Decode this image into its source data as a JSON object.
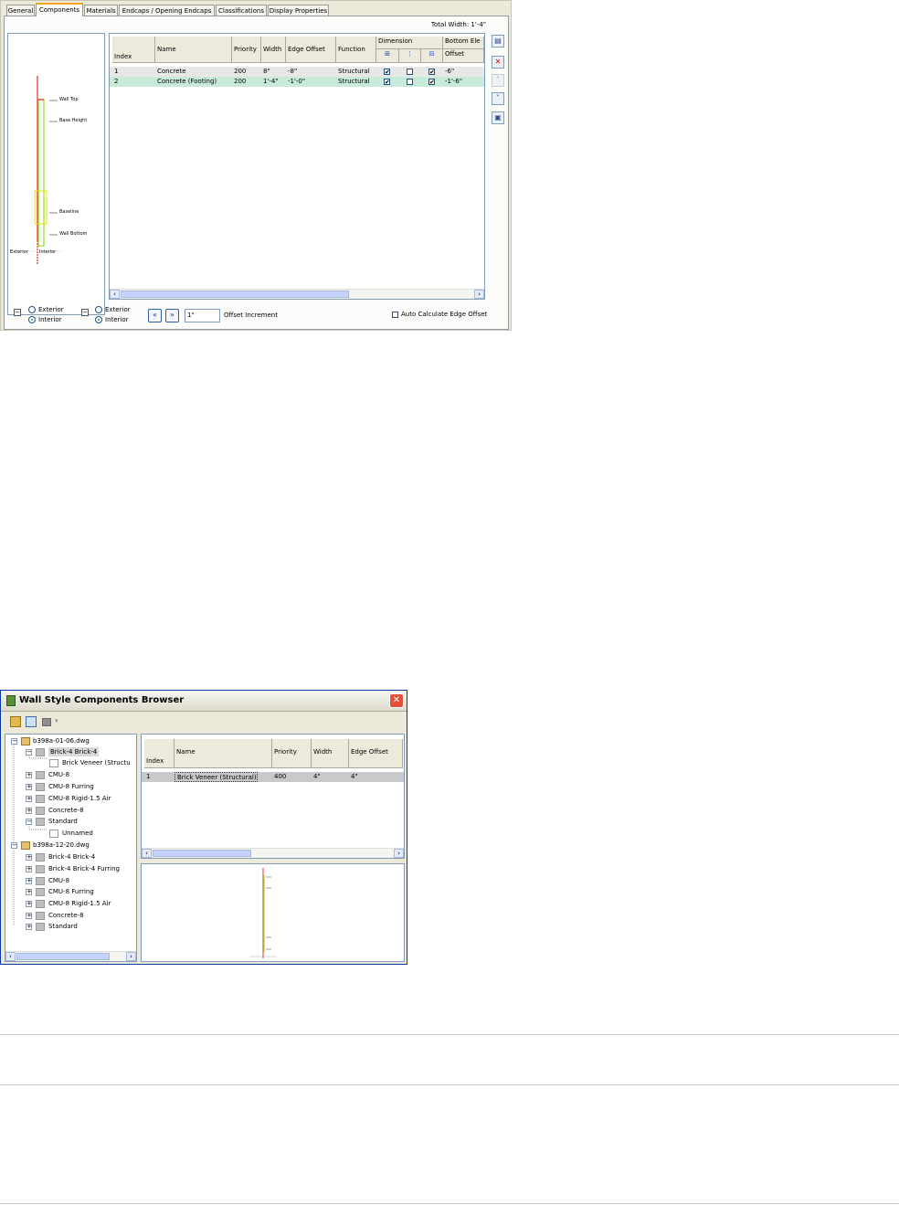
{
  "dialog1": {
    "tabs": [
      "General",
      "Components",
      "Materials",
      "Endcaps / Opening Endcaps",
      "Classifications",
      "Display Properties"
    ],
    "total_width_label": "Total Width: 1'-4\"",
    "preview_labels": {
      "wall_top": "Wall Top",
      "base_height": "Base Height",
      "baseline": "Baseline",
      "wall_bottom": "Wall Bottom",
      "exterior": "Exterior",
      "interior": "Interior"
    },
    "grid": {
      "headers": {
        "index": "Index",
        "name": "Name",
        "priority": "Priority",
        "width": "Width",
        "edge_offset": "Edge Offset",
        "function": "Function",
        "dimension": "Dimension",
        "bottom_elevation": "Bottom Ele",
        "offset": "Offset"
      },
      "rows": [
        {
          "index": "1",
          "name": "Concrete",
          "priority": "200",
          "width": "8\"",
          "edge_offset": "-8\"",
          "function": "Structural",
          "dim1": "✔",
          "dim2": "",
          "dim3": "✔",
          "offset": "-6\""
        },
        {
          "index": "2",
          "name": "Concrete (Footing)",
          "priority": "200",
          "width": "1'-4\"",
          "edge_offset": "-1'-0\"",
          "function": "Structural",
          "dim1": "✔",
          "dim2": "",
          "dim3": "✔",
          "offset": "-1'-6\""
        }
      ]
    },
    "bottom": {
      "exterior": "Exterior",
      "interior": "Interior",
      "offset_value": "1\"",
      "offset_increment": "Offset Increment",
      "auto_calc": "Auto Calculate Edge Offset"
    }
  },
  "dialog2": {
    "title": "Wall Style Components Browser",
    "tree": [
      {
        "label": "b398a-01-06.dwg"
      },
      {
        "label": "Brick-4 Brick-4"
      },
      {
        "label": "Brick Veneer (Structu"
      },
      {
        "label": "CMU-8"
      },
      {
        "label": "CMU-8 Furring"
      },
      {
        "label": "CMU-8 Rigid-1.5 Air"
      },
      {
        "label": "Concrete-8"
      },
      {
        "label": "Standard"
      },
      {
        "label": "Unnamed"
      },
      {
        "label": "b398a-12-20.dwg"
      },
      {
        "label": "Brick-4 Brick-4"
      },
      {
        "label": "Brick-4 Brick-4 Furring"
      },
      {
        "label": "CMU-8"
      },
      {
        "label": "CMU-8 Furring"
      },
      {
        "label": "CMU-8 Rigid-1.5 Air"
      },
      {
        "label": "Concrete-8"
      },
      {
        "label": "Standard"
      }
    ],
    "grid": {
      "headers": {
        "index": "Index",
        "name": "Name",
        "priority": "Priority",
        "width": "Width",
        "edge_offset": "Edge Offset"
      },
      "rows": [
        {
          "index": "1",
          "name": "Brick Veneer (Structural)",
          "priority": "400",
          "width": "4\"",
          "edge_offset": "4\""
        }
      ]
    }
  }
}
